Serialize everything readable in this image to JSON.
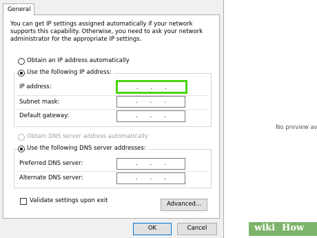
{
  "tab": {
    "label": "General"
  },
  "intro": "You can get IP settings assigned automatically if your network supports this capability. Otherwise, you need to ask your network administrator for the appropriate IP settings.",
  "ip_mode": {
    "auto_label": "Obtain an IP address automatically",
    "manual_label": "Use the following IP address:",
    "selected": "manual"
  },
  "ip_fields": [
    {
      "label": "IP address:",
      "value": ".  .  .",
      "highlighted": true
    },
    {
      "label": "Subnet mask:",
      "value": ".  .  .",
      "highlighted": false
    },
    {
      "label": "Default gateway:",
      "value": ".  .  .",
      "highlighted": false
    }
  ],
  "dns_mode": {
    "auto_label": "Obtain DNS server address automatically",
    "manual_label": "Use the following DNS server addresses:",
    "selected": "manual"
  },
  "dns_fields": [
    {
      "label": "Preferred DNS server:",
      "value": ".  .  ."
    },
    {
      "label": "Alternate DNS server:",
      "value": ".  .  ."
    }
  ],
  "validate": {
    "label": "Validate settings upon exit",
    "checked": false
  },
  "buttons": {
    "advanced": "Advanced...",
    "ok": "OK",
    "cancel": "Cancel"
  },
  "preview_text": "No preview av",
  "watermark": {
    "wiki": "wiki",
    "how": "How"
  },
  "colors": {
    "highlight": "#4cd40f",
    "watermark_bg": "#7cb46a"
  }
}
